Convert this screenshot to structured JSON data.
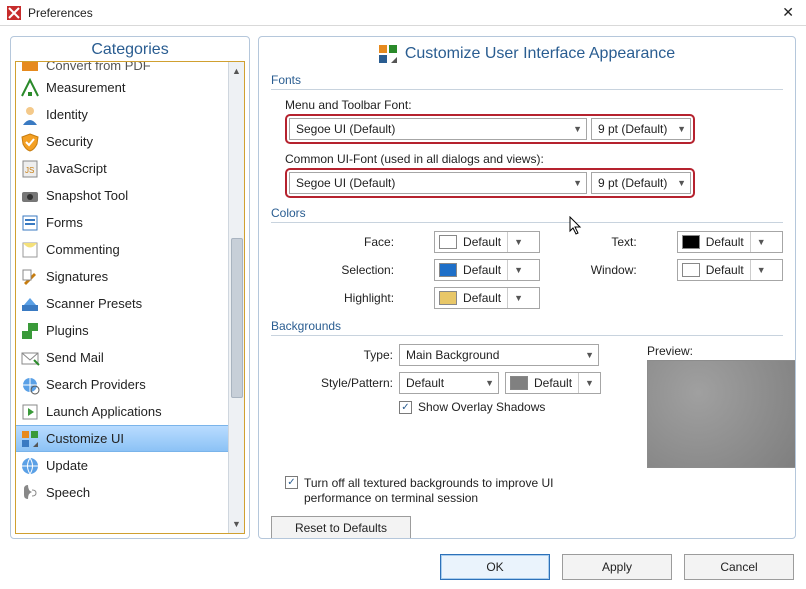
{
  "window": {
    "title": "Preferences"
  },
  "categories": {
    "header": "Categories",
    "items": [
      {
        "label": "Convert from PDF"
      },
      {
        "label": "Measurement"
      },
      {
        "label": "Identity"
      },
      {
        "label": "Security"
      },
      {
        "label": "JavaScript"
      },
      {
        "label": "Snapshot Tool"
      },
      {
        "label": "Forms"
      },
      {
        "label": "Commenting"
      },
      {
        "label": "Signatures"
      },
      {
        "label": "Scanner Presets"
      },
      {
        "label": "Plugins"
      },
      {
        "label": "Send Mail"
      },
      {
        "label": "Search Providers"
      },
      {
        "label": "Launch Applications"
      },
      {
        "label": "Customize UI",
        "selected": true
      },
      {
        "label": "Update"
      },
      {
        "label": "Speech"
      }
    ]
  },
  "main": {
    "title": "Customize User Interface Appearance",
    "fonts": {
      "section": "Fonts",
      "menu_label": "Menu and Toolbar Font:",
      "menu_font": "Segoe UI (Default)",
      "menu_size": "9 pt (Default)",
      "common_label": "Common UI-Font (used in all dialogs and views):",
      "common_font": "Segoe UI (Default)",
      "common_size": "9 pt (Default)"
    },
    "colors": {
      "section": "Colors",
      "face": {
        "label": "Face:",
        "value": "Default",
        "swatch": "#ffffff"
      },
      "text": {
        "label": "Text:",
        "value": "Default",
        "swatch": "#000000"
      },
      "selection": {
        "label": "Selection:",
        "value": "Default",
        "swatch": "#1e6fc8"
      },
      "window": {
        "label": "Window:",
        "value": "Default",
        "swatch": "#ffffff"
      },
      "highlight": {
        "label": "Highlight:",
        "value": "Default",
        "swatch": "#e8c768"
      }
    },
    "backgrounds": {
      "section": "Backgrounds",
      "type_label": "Type:",
      "type_value": "Main Background",
      "style_label": "Style/Pattern:",
      "style_value": "Default",
      "style_color_value": "Default",
      "style_color_swatch": "#808080",
      "overlay_label": "Show Overlay Shadows",
      "overlay_checked": true,
      "terminal_label": "Turn off all textured backgrounds to improve UI performance on terminal session",
      "terminal_checked": true,
      "preview_label": "Preview:"
    },
    "reset_label": "Reset to Defaults"
  },
  "buttons": {
    "ok": "OK",
    "apply": "Apply",
    "cancel": "Cancel"
  }
}
